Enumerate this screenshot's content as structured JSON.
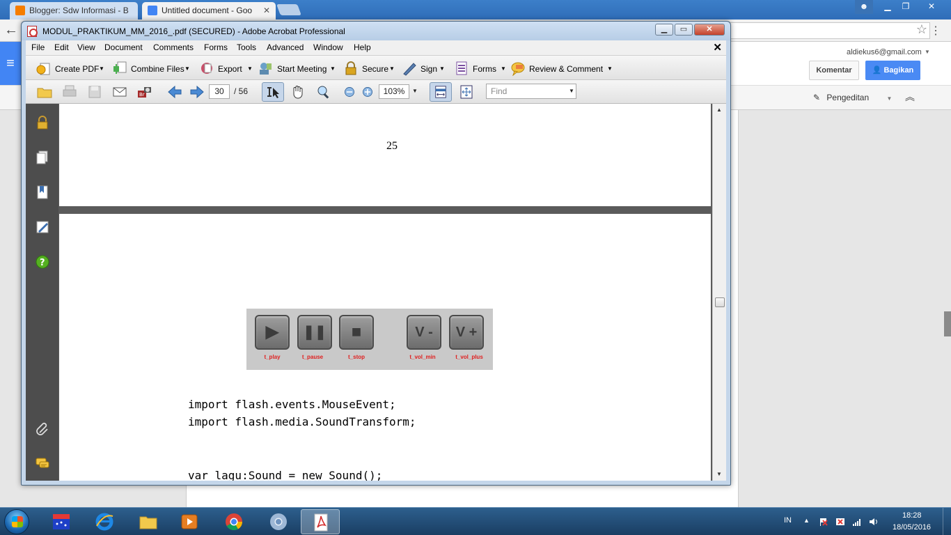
{
  "browser": {
    "tabs": [
      {
        "title": "Blogger: Sdw Informasi - B"
      },
      {
        "title": "Untitled document - Goo"
      }
    ]
  },
  "gdocs": {
    "email": "aldiekus6@gmail.com",
    "komentar_label": "Komentar",
    "bagikan_label": "Bagikan",
    "mode_label": "Pengeditan"
  },
  "acrobat": {
    "title": "MODUL_PRAKTIKUM_MM_2016_.pdf (SECURED) - Adobe Acrobat Professional",
    "menu": [
      "File",
      "Edit",
      "View",
      "Document",
      "Comments",
      "Forms",
      "Tools",
      "Advanced",
      "Window",
      "Help"
    ],
    "tools": {
      "create_pdf": "Create PDF",
      "combine_files": "Combine Files",
      "export": "Export",
      "start_meeting": "Start Meeting",
      "secure": "Secure",
      "sign": "Sign",
      "forms": "Forms",
      "review_comment": "Review & Comment"
    },
    "nav": {
      "current_page": "30",
      "total_pages": "/ 56",
      "zoom": "103%",
      "find_placeholder": "Find"
    },
    "document": {
      "page_number": "25",
      "player_labels": [
        "t_play",
        "t_pause",
        "t_stop",
        "t_vol_min",
        "t_vol_plus"
      ],
      "player_glyphs": [
        "▶",
        "❚❚",
        "■",
        "V -",
        "V +"
      ],
      "code_lines": [
        "import flash.events.MouseEvent;",
        "import flash.media.SoundTransform;",
        "var lagu:Sound = new Sound();"
      ]
    }
  },
  "taskbar": {
    "language": "IN",
    "time": "18:28",
    "date": "18/05/2016"
  },
  "colors": {
    "acrobat_frame": "#c4d6ea",
    "side_panel": "#4d4d4d",
    "viewer_bg": "#5b5b5b",
    "player_label": "#e02020",
    "gdocs_blue": "#4a8af4"
  }
}
